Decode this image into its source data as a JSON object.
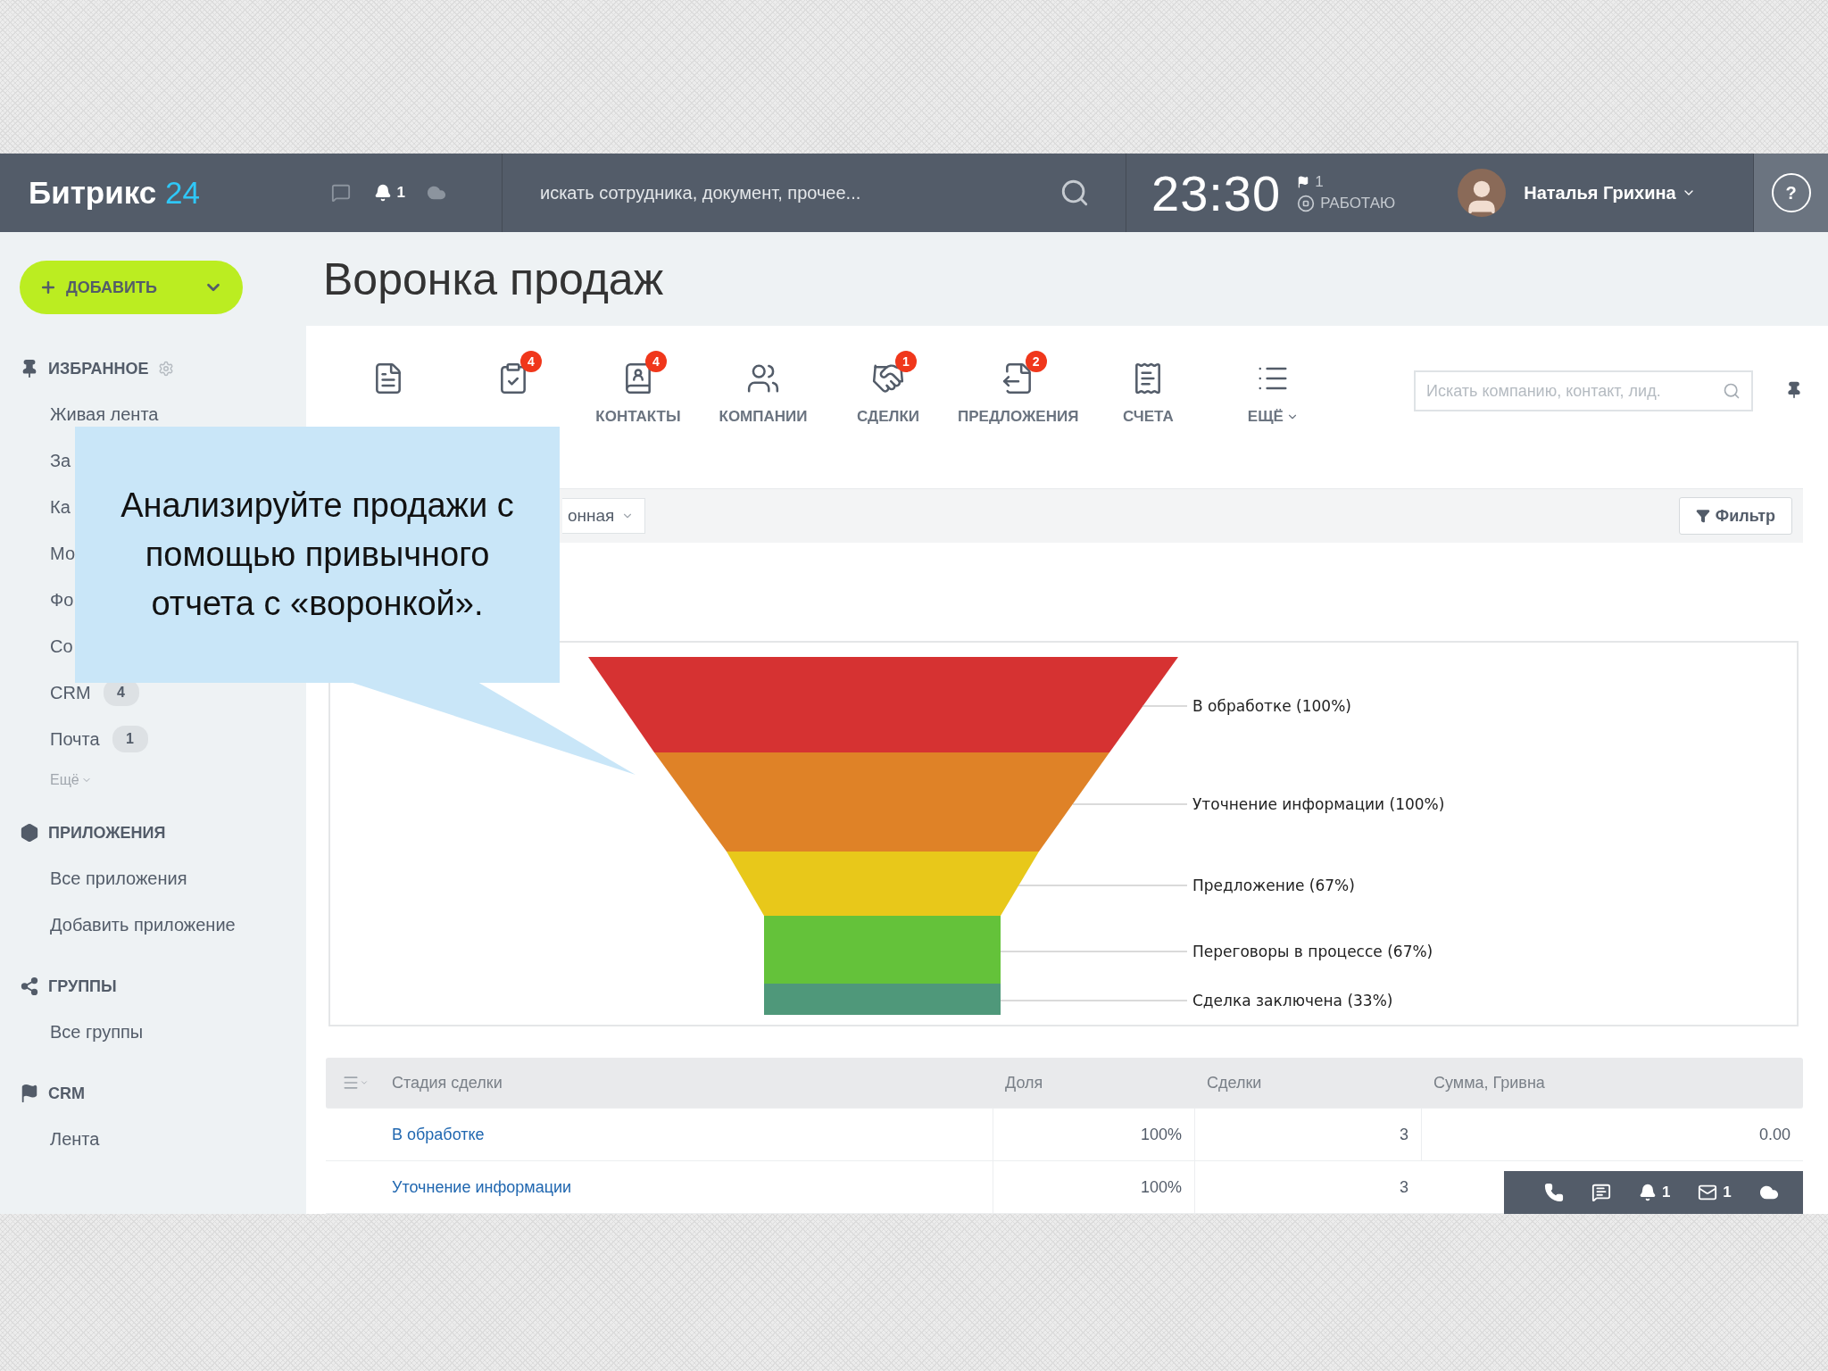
{
  "header": {
    "logo": {
      "name": "Битрикс",
      "number": "24"
    },
    "notifications": "1",
    "search": {
      "placeholder": "искать сотрудника, документ, прочее..."
    },
    "clock": "23:30",
    "flag_count": "1",
    "status": "РАБОТАЮ",
    "user": "Наталья Грихина",
    "help": "?"
  },
  "add_button": "ДОБАВИТЬ",
  "sidebar": {
    "sections": [
      {
        "title": "ИЗБРАННОЕ",
        "items": [
          {
            "label": "Живая лента"
          },
          {
            "label": "За"
          },
          {
            "label": "Ка"
          },
          {
            "label": "Мо"
          },
          {
            "label": "Фо"
          },
          {
            "label": "Со"
          },
          {
            "label": "CRM",
            "count": "4"
          },
          {
            "label": "Почта",
            "count": "1"
          }
        ],
        "more": "Ещё"
      },
      {
        "title": "ПРИЛОЖЕНИЯ",
        "items": [
          {
            "label": "Все приложения"
          },
          {
            "label": "Добавить приложение"
          }
        ]
      },
      {
        "title": "ГРУППЫ",
        "items": [
          {
            "label": "Все группы"
          }
        ]
      },
      {
        "title": "CRM",
        "items": [
          {
            "label": "Лента"
          }
        ]
      }
    ]
  },
  "page_title": "Воронка продаж",
  "toolbar": {
    "items": [
      {
        "kind": "icon"
      },
      {
        "kind": "icon",
        "badge": "4"
      },
      {
        "kind": "tab",
        "label": "КОНТАКТЫ",
        "badge": "4"
      },
      {
        "kind": "tab",
        "label": "КОМПАНИИ"
      },
      {
        "kind": "tab",
        "label": "СДЕЛКИ",
        "badge": "1"
      },
      {
        "kind": "tab",
        "label": "ПРЕДЛОЖЕНИЯ",
        "badge": "2"
      },
      {
        "kind": "tab",
        "label": "СЧЕТА"
      },
      {
        "kind": "tab",
        "label": "ЕЩЁ",
        "dropdown": true
      }
    ],
    "search": {
      "placeholder": "Искать компанию, контакт, лид."
    }
  },
  "filter_bar": {
    "view": "онная",
    "filter_button": "Фильтр"
  },
  "funnel": {
    "stages": [
      {
        "label": "В обработке (100%)",
        "color": "#d63232"
      },
      {
        "label": "Уточнение информации (100%)",
        "color": "#df8227"
      },
      {
        "label": "Предложение (67%)",
        "color": "#e8c81a"
      },
      {
        "label": "Переговоры в процессе (67%)",
        "color": "#64c23a"
      },
      {
        "label": "Сделка заключена (33%)",
        "color": "#4f987a"
      }
    ]
  },
  "table": {
    "columns": [
      "Стадия сделки",
      "Доля",
      "Сделки",
      "Сумма, Гривна"
    ],
    "rows": [
      {
        "cells": [
          "В обработке",
          "100%",
          "3",
          "0.00"
        ]
      },
      {
        "cells": [
          "Уточнение информации",
          "100%",
          "3"
        ]
      }
    ]
  },
  "dock": {
    "notifications": "1",
    "messages": "1"
  },
  "callout": {
    "text": "Анализируйте продажи с помощью привычного отчета с «воронкой»."
  }
}
